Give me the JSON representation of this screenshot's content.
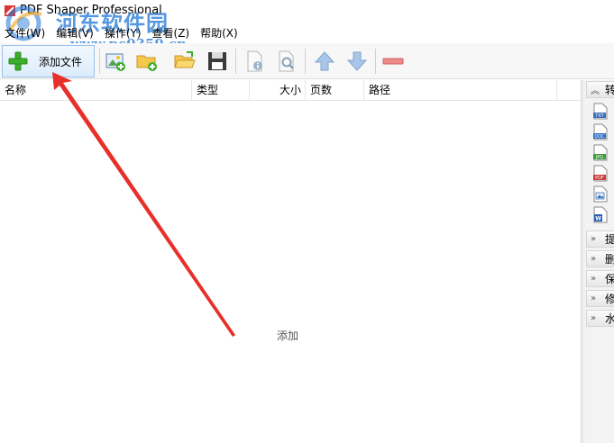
{
  "window": {
    "title": "PDF Shaper Professional"
  },
  "watermark": {
    "site_name": "河东软件园",
    "url": "www.pc0359.cn"
  },
  "menu": [
    {
      "label": "文件(W)"
    },
    {
      "label": "编辑(V)"
    },
    {
      "label": "操作(Y)"
    },
    {
      "label": "查看(Z)"
    },
    {
      "label": "帮助(X)"
    }
  ],
  "toolbar": {
    "add_files_label": "添加文件",
    "icons": [
      "add-image-icon",
      "add-folder-icon",
      "open-folder-icon",
      "save-icon",
      "document-info-icon",
      "preview-icon",
      "move-up-icon",
      "move-down-icon",
      "remove-icon"
    ]
  },
  "file_list": {
    "columns": [
      "名称",
      "类型",
      "大小",
      "页数",
      "路径"
    ],
    "empty_hint": "添加"
  },
  "right_panel": {
    "sections": [
      {
        "label": "转",
        "expanded": true
      },
      {
        "label": "提",
        "expanded": false
      },
      {
        "label": "删",
        "expanded": false
      },
      {
        "label": "保",
        "expanded": false
      },
      {
        "label": "修",
        "expanded": false
      },
      {
        "label": "水",
        "expanded": false
      }
    ],
    "convert_items": [
      {
        "icon": "txt-file-icon",
        "tag": "TXT",
        "color": "#3a6fb5"
      },
      {
        "icon": "doc-file-icon",
        "tag": "DOC",
        "color": "#2b6cc4"
      },
      {
        "icon": "jpg-file-icon",
        "tag": "JPG",
        "color": "#3d9a3d"
      },
      {
        "icon": "pdf-file-icon",
        "tag": "PDF",
        "color": "#c83a3a"
      },
      {
        "icon": "image-file-icon",
        "tag": "",
        "color": "#3a6fb5"
      },
      {
        "icon": "word-file-icon",
        "tag": "W",
        "color": "#2b5fb8"
      }
    ]
  },
  "colors": {
    "arrow": "#e8302a",
    "accent": "#2f7fd8",
    "button_border": "#99c1ea"
  }
}
